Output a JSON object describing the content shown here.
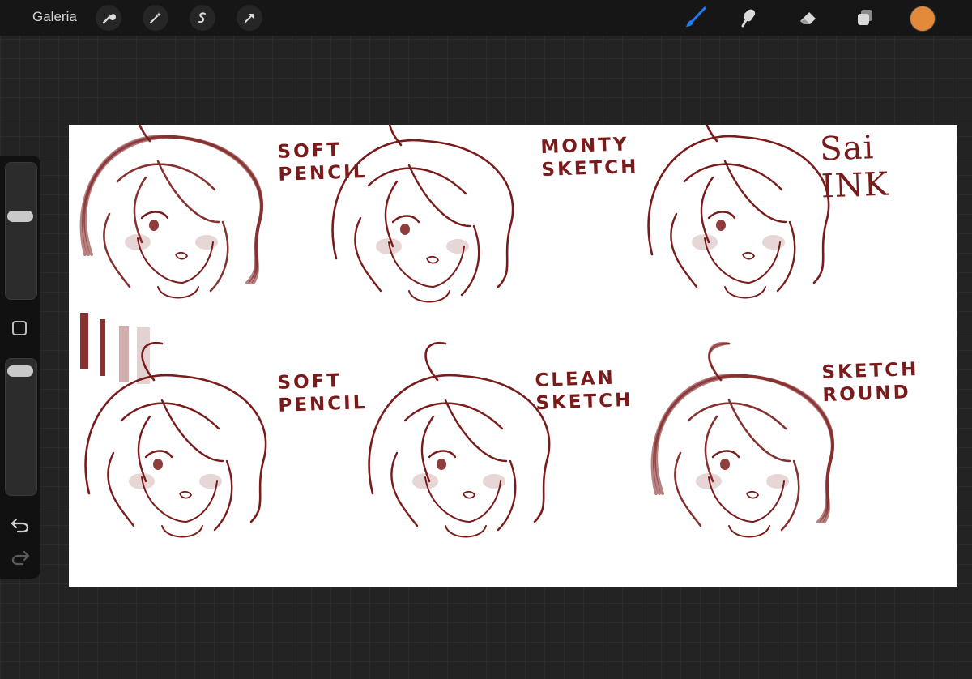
{
  "toolbar": {
    "gallery_label": "Galeria",
    "left_tools": [
      "wrench-icon",
      "magic-wand-icon",
      "selection-icon",
      "transform-arrow-icon"
    ],
    "right_tools": [
      "brush-icon",
      "smudge-icon",
      "eraser-icon",
      "layers-icon"
    ],
    "active_tool": "brush-icon",
    "accent_color": "#1f7bf5",
    "current_color": "#e28a3a"
  },
  "sidebar": {
    "brush_size_level": 0.62,
    "opacity_level": 0.96,
    "modify_button": "modify-square-icon",
    "undo_icon": "undo-icon",
    "redo_icon": "redo-icon"
  },
  "canvas": {
    "ink_color": "#7a1b1b",
    "labels": [
      {
        "id": "soft-pencil-top",
        "text": "SOFT\nPENCIL"
      },
      {
        "id": "monty-sketch",
        "text": "MONTY\nSKETCH"
      },
      {
        "id": "sai-ink",
        "text": "Sai\nINK"
      },
      {
        "id": "soft-pencil-bottom",
        "text": "SOFT\nPENCIL"
      },
      {
        "id": "clean-sketch",
        "text": "CLEAN\nSKETCH"
      },
      {
        "id": "sketch-round",
        "text": "SKETCH\nROUND"
      }
    ]
  }
}
